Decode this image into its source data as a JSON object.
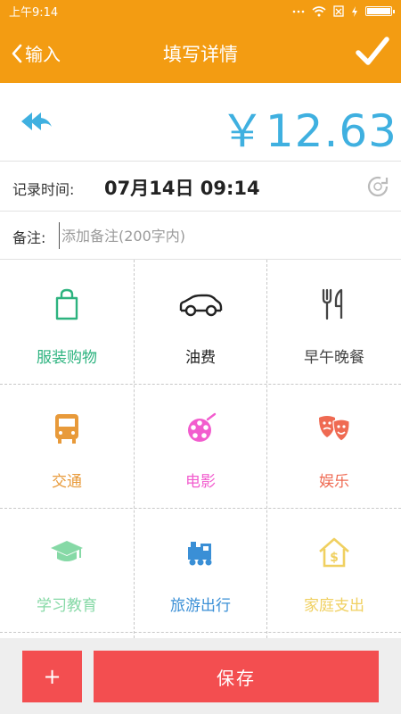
{
  "status_bar": {
    "time": "上午9:14"
  },
  "nav": {
    "back_label": "输入",
    "title": "填写详情"
  },
  "amount": {
    "value": "￥12.63"
  },
  "record_time": {
    "label": "记录时间:",
    "value": "07月14日 09:14"
  },
  "note": {
    "label": "备注:",
    "placeholder": "添加备注(200字内)",
    "value": ""
  },
  "categories": [
    {
      "label": "服装购物",
      "icon": "shopping-bag-icon",
      "color": "#2db37f"
    },
    {
      "label": "油费",
      "icon": "car-icon",
      "color": "#222222"
    },
    {
      "label": "早午晚餐",
      "icon": "fork-knife-icon",
      "color": "#444444"
    },
    {
      "label": "交通",
      "icon": "bus-icon",
      "color": "#e89a3a"
    },
    {
      "label": "电影",
      "icon": "film-reel-icon",
      "color": "#f25cce"
    },
    {
      "label": "娱乐",
      "icon": "theater-masks-icon",
      "color": "#ef6a52"
    },
    {
      "label": "学习教育",
      "icon": "graduation-cap-icon",
      "color": "#86d9a6"
    },
    {
      "label": "旅游出行",
      "icon": "train-icon",
      "color": "#3a8fd6"
    },
    {
      "label": "家庭支出",
      "icon": "house-dollar-icon",
      "color": "#f0d060"
    }
  ],
  "bottom": {
    "add_label": "+",
    "save_label": "保存"
  },
  "colors": {
    "accent": "#f39c12",
    "amount": "#3fb0e0",
    "button": "#f34e50"
  }
}
